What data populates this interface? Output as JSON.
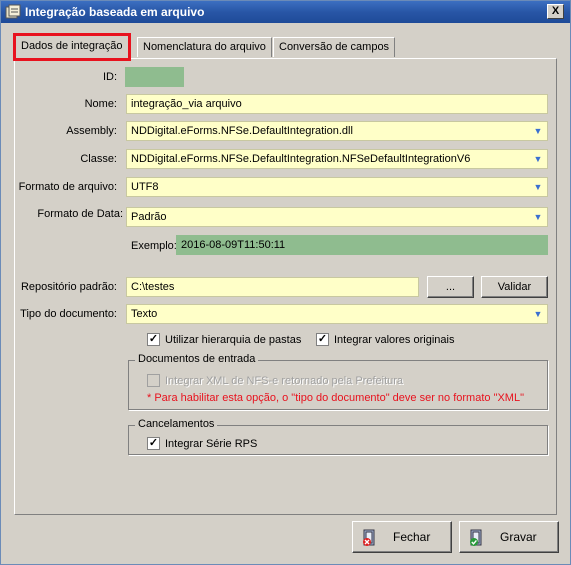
{
  "window": {
    "title": "Integração baseada em arquivo",
    "close_label": "X"
  },
  "tabs": [
    {
      "label": "Dados de integração",
      "active": true
    },
    {
      "label": "Nomenclatura do arquivo",
      "active": false
    },
    {
      "label": "Conversão de campos",
      "active": false
    }
  ],
  "form": {
    "id_label": "ID:",
    "id_value": "",
    "nome_label": "Nome:",
    "nome_value": "integração_via arquivo",
    "assembly_label": "Assembly:",
    "assembly_value": "NDDigital.eForms.NFSe.DefaultIntegration.dll",
    "classe_label": "Classe:",
    "classe_value": "NDDigital.eForms.NFSe.DefaultIntegration.NFSeDefaultIntegrationV6",
    "formato_arquivo_label": "Formato de arquivo:",
    "formato_arquivo_value": "UTF8",
    "formato_data_label": "Formato de Data:",
    "formato_data_value": "Padrão",
    "exemplo_label": "Exemplo:",
    "exemplo_value": "2016-08-09T11:50:11",
    "repositorio_label": "Repositório padrão:",
    "repositorio_value": "C:\\testes",
    "browse_label": "...",
    "validar_label": "Validar",
    "tipo_doc_label": "Tipo do documento:",
    "tipo_doc_value": "Texto",
    "hierarquia_label": "Utilizar hierarquia de pastas",
    "hierarquia_checked": true,
    "valores_originais_label": "Integrar valores originais",
    "valores_originais_checked": true
  },
  "docs_entrada": {
    "legend": "Documentos de entrada",
    "xml_label": "Integrar XML de NFS-e retornado pela Prefeitura",
    "xml_checked": false,
    "note": "* Para habilitar esta opção, o \"tipo do documento\" deve ser no formato \"XML\""
  },
  "cancelamentos": {
    "legend": "Cancelamentos",
    "serie_label": "Integrar Série RPS",
    "serie_checked": true
  },
  "footer": {
    "fechar_label": "Fechar",
    "gravar_label": "Gravar"
  },
  "colors": {
    "title_bar": "#2856a6",
    "field_bg": "#ffffc8",
    "readonly_bg": "#8fbc8f",
    "highlight": "#e8121e"
  }
}
